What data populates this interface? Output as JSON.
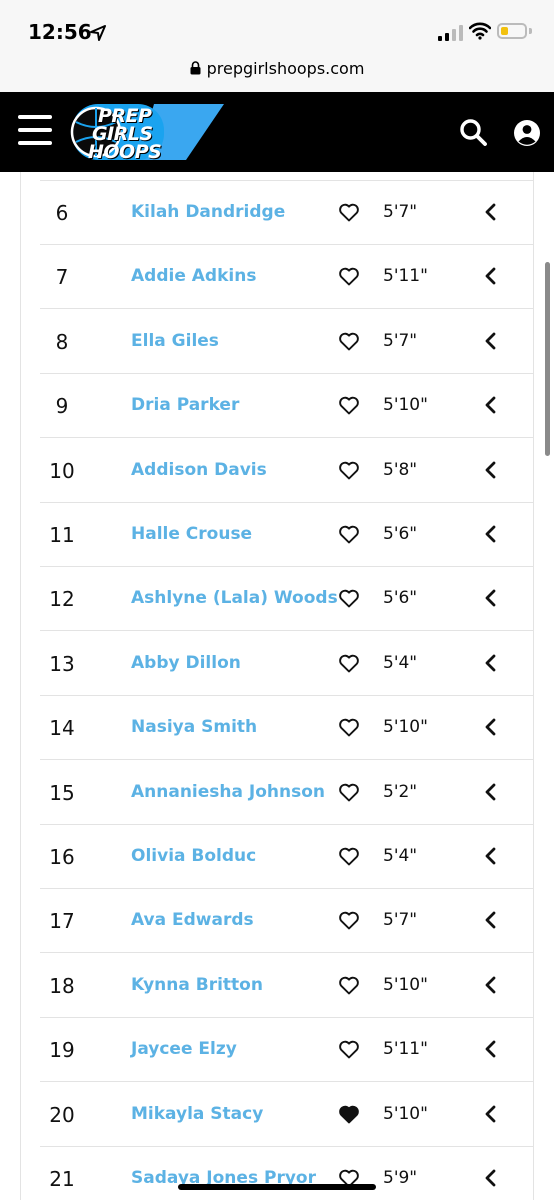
{
  "status_bar": {
    "time": "12:56"
  },
  "url_bar": {
    "domain": "prepgirlshoops.com"
  },
  "site_header": {
    "logo_lines": [
      "PREP",
      "GIRLS",
      "HOOPS"
    ]
  },
  "rankings": [
    {
      "rank": "6",
      "name": "Kilah Dandridge",
      "height": "5'7\"",
      "favorited": false
    },
    {
      "rank": "7",
      "name": "Addie Adkins",
      "height": "5'11\"",
      "favorited": false
    },
    {
      "rank": "8",
      "name": "Ella Giles",
      "height": "5'7\"",
      "favorited": false
    },
    {
      "rank": "9",
      "name": "Dria Parker",
      "height": "5'10\"",
      "favorited": false
    },
    {
      "rank": "10",
      "name": "Addison Davis",
      "height": "5'8\"",
      "favorited": false
    },
    {
      "rank": "11",
      "name": "Halle Crouse",
      "height": "5'6\"",
      "favorited": false
    },
    {
      "rank": "12",
      "name": "Ashlyne (Lala) Woods",
      "height": "5'6\"",
      "favorited": false
    },
    {
      "rank": "13",
      "name": "Abby Dillon",
      "height": "5'4\"",
      "favorited": false
    },
    {
      "rank": "14",
      "name": "Nasiya Smith",
      "height": "5'10\"",
      "favorited": false
    },
    {
      "rank": "15",
      "name": "Annaniesha Johnson",
      "height": "5'2\"",
      "favorited": false
    },
    {
      "rank": "16",
      "name": "Olivia Bolduc",
      "height": "5'4\"",
      "favorited": false
    },
    {
      "rank": "17",
      "name": "Ava Edwards",
      "height": "5'7\"",
      "favorited": false
    },
    {
      "rank": "18",
      "name": "Kynna Britton",
      "height": "5'10\"",
      "favorited": false
    },
    {
      "rank": "19",
      "name": "Jaycee Elzy",
      "height": "5'11\"",
      "favorited": false
    },
    {
      "rank": "20",
      "name": "Mikayla Stacy",
      "height": "5'10\"",
      "favorited": true
    },
    {
      "rank": "21",
      "name": "Sadaya Jones Pryor",
      "height": "5'9\"",
      "favorited": false
    }
  ],
  "colors": {
    "name_link": "#5cb2e4",
    "logo_blue": "#3aa7f0",
    "header_bg": "#000000"
  }
}
